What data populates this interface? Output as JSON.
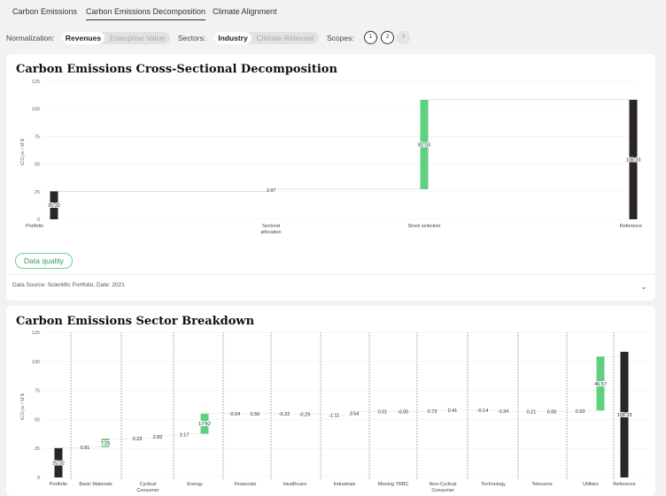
{
  "tabs": [
    {
      "label": "Carbon Emissions",
      "active": false
    },
    {
      "label": "Carbon Emissions Decomposition",
      "active": true
    },
    {
      "label": "Climate Alignment",
      "active": false
    }
  ],
  "controls": {
    "normalization_label": "Normalization:",
    "normalization_options": [
      "Revenues",
      "Enterprise Value"
    ],
    "sectors_label": "Sectors:",
    "sectors_options": [
      "Industry",
      "Climate Relevant"
    ],
    "scopes_label": "Scopes:",
    "scopes": [
      "1",
      "2",
      "3"
    ]
  },
  "card1": {
    "title": "Carbon Emissions Cross-Sectional Decomposition",
    "data_quality_label": "Data quality",
    "source": "Data Source: Scientific Portfolio, Date: 2021",
    "chevron": "⌄"
  },
  "card2": {
    "title": "Carbon Emissions Sector Breakdown"
  },
  "colors": {
    "dark": "#2b2524",
    "green": "#5dd180",
    "red": "#e05353"
  },
  "chart_data": [
    {
      "type": "waterfall",
      "title": "Carbon Emissions Cross-Sectional Decomposition",
      "ylabel": "tCO₂/e / M $",
      "ylim": [
        0,
        125
      ],
      "yticks": [
        0,
        25,
        50,
        75,
        100,
        125
      ],
      "categories": [
        "Portfolio",
        "Sectoral\nallocation",
        "Stock selection",
        "Reference"
      ],
      "labels": [
        "25.32",
        "1.97",
        "81.03",
        "108.33"
      ],
      "values": [
        25.32,
        1.97,
        81.03,
        108.33
      ],
      "kinds": [
        "total",
        "delta",
        "delta",
        "total"
      ]
    },
    {
      "type": "waterfall",
      "title": "Carbon Emissions Sector Breakdown",
      "ylabel": "tCO₂/e / M $",
      "ylim": [
        0,
        125
      ],
      "yticks": [
        0,
        25,
        50,
        75,
        100,
        125
      ],
      "categories": [
        "Portfolio",
        "Basic Materials",
        "Cyclical\nConsumer",
        "Energy",
        "Financials",
        "Healthcare",
        "Industrials",
        "Missing TRBC",
        "Non-Cyclical\nConsumer",
        "Technology",
        "Telecoms",
        "Utilities",
        "Reference"
      ],
      "labels": [
        "25.32",
        "0.81",
        "7.25",
        "0.23",
        "2.82",
        "1.17",
        "17.42",
        "-0.54",
        "0.56",
        "-0.32",
        "-0.29",
        "-1.11",
        "3.54",
        "0.01",
        "-0.00",
        "0.73",
        "0.41",
        "-0.14",
        "-1.34",
        "0.21",
        "0.00",
        "0.93",
        "46.57",
        "108.33"
      ],
      "values": [
        25.32,
        0.81,
        7.25,
        0.23,
        2.82,
        1.17,
        17.42,
        -0.54,
        0.56,
        -0.32,
        -0.29,
        -1.11,
        3.54,
        0.01,
        -0.0,
        0.73,
        0.41,
        -0.14,
        -1.34,
        0.21,
        0.0,
        0.93,
        46.57,
        108.33
      ],
      "groups": [
        0,
        1,
        1,
        2,
        2,
        3,
        3,
        4,
        4,
        5,
        5,
        6,
        6,
        7,
        7,
        8,
        8,
        9,
        9,
        10,
        10,
        11,
        11,
        12
      ],
      "kinds": [
        "total",
        "delta",
        "delta",
        "delta",
        "delta",
        "delta",
        "delta",
        "delta",
        "delta",
        "delta",
        "delta",
        "delta",
        "delta",
        "delta",
        "delta",
        "delta",
        "delta",
        "delta",
        "delta",
        "delta",
        "delta",
        "delta",
        "delta",
        "total"
      ]
    }
  ]
}
